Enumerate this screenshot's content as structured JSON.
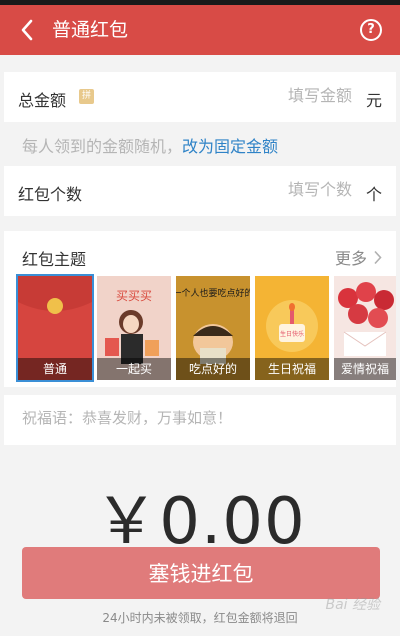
{
  "header": {
    "title": "普通红包",
    "back_icon": "chevron-left-icon",
    "help_label": "?"
  },
  "total_amount": {
    "label": "总金额",
    "badge": "拼",
    "placeholder": "填写金额",
    "unit": "元"
  },
  "mode_hint": {
    "text": "每人领到的金额随机，",
    "link": "改为固定金额"
  },
  "count": {
    "label": "红包个数",
    "placeholder": "填写个数",
    "unit": "个"
  },
  "themes": {
    "title": "红包主题",
    "more_label": "更多",
    "items": [
      {
        "caption": "普通",
        "selected": true
      },
      {
        "caption": "一起买",
        "selected": false
      },
      {
        "caption": "吃点好的",
        "selected": false
      },
      {
        "caption": "生日祝福",
        "selected": false
      },
      {
        "caption": "爱情祝福",
        "selected": false
      }
    ],
    "art_text": {
      "yiqimai": "买买买",
      "chidianhaode": "一个人也要吃点好的",
      "birthday": "生日快乐"
    }
  },
  "blessing": {
    "placeholder": "祝福语：恭喜发财，万事如意！"
  },
  "amount_display": "￥0.00",
  "submit_label": "塞钱进红包",
  "notice": "24小时内未被领取，红包金额将退回",
  "watermark": "Bai 经验",
  "colors": {
    "header": "#d84b46",
    "button": "#e07b7b",
    "link": "#2f83c7"
  }
}
